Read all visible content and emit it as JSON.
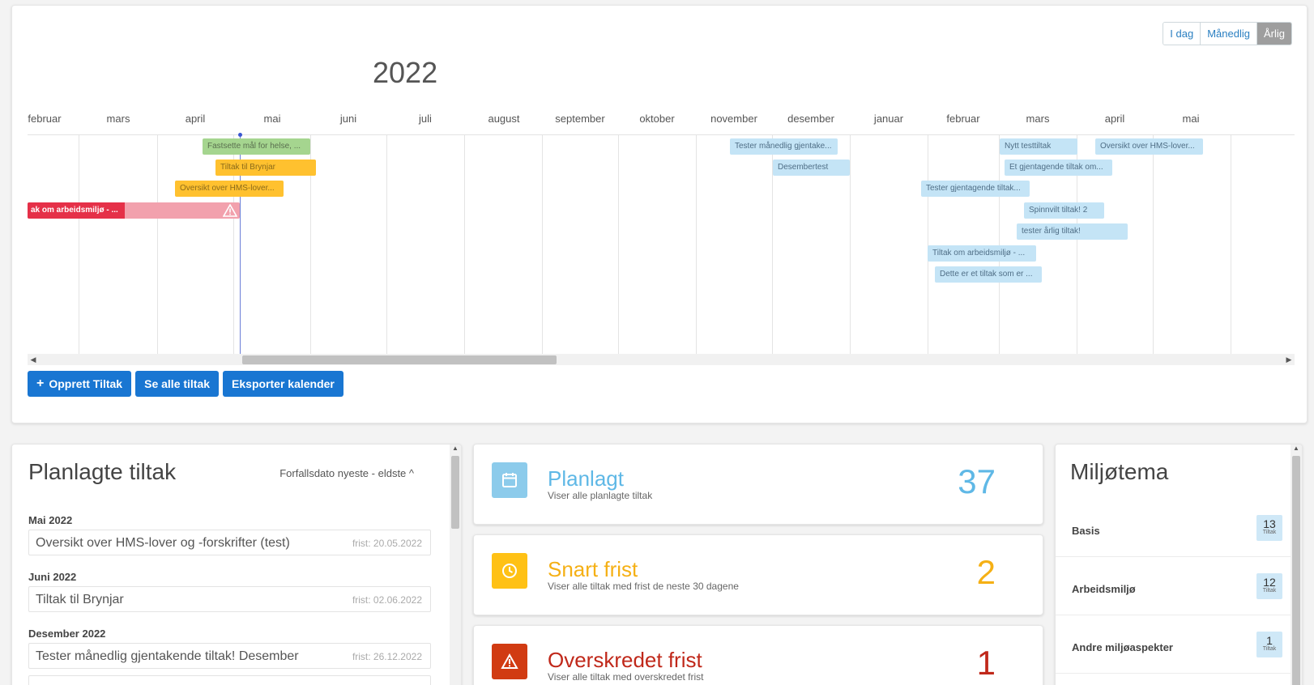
{
  "calendar": {
    "year": "2022",
    "view_buttons": [
      {
        "label": "I dag",
        "active": false
      },
      {
        "label": "Månedlig",
        "active": false
      },
      {
        "label": "Årlig",
        "active": true
      }
    ],
    "months": [
      "februar",
      "mars",
      "april",
      "mai",
      "juni",
      "juli",
      "august",
      "september",
      "oktober",
      "november",
      "desember",
      "januar",
      "februar",
      "mars",
      "april",
      "mai"
    ],
    "events": [
      {
        "label": "Fastsette mål for helse, ...",
        "color": "green"
      },
      {
        "label": "Tiltak til Brynjar",
        "color": "orange"
      },
      {
        "label": "Oversikt over HMS-lover...",
        "color": "orange"
      },
      {
        "label": "ak om arbeidsmiljø - ...",
        "color": "red"
      },
      {
        "label": "Tester månedlig gjentake...",
        "color": "blue"
      },
      {
        "label": "Desembertest",
        "color": "blue"
      },
      {
        "label": "Nytt testtiltak",
        "color": "blue"
      },
      {
        "label": "Oversikt over HMS-lover...",
        "color": "blue"
      },
      {
        "label": "Et gjentagende tiltak om...",
        "color": "blue"
      },
      {
        "label": "Tester gjentagende tiltak...",
        "color": "blue"
      },
      {
        "label": "Spinnvilt tiltak! 2",
        "color": "blue"
      },
      {
        "label": "tester årlig tiltak!",
        "color": "blue"
      },
      {
        "label": "Tiltak om arbeidsmiljø - ...",
        "color": "blue"
      },
      {
        "label": "Dette er et tiltak som er ...",
        "color": "blue"
      }
    ],
    "actions": {
      "create": "Opprett Tiltak",
      "see_all": "Se alle tiltak",
      "export": "Eksporter kalender"
    }
  },
  "planned": {
    "title": "Planlagte tiltak",
    "sort_label": "Forfallsdato nyeste - eldste ^",
    "groups": [
      {
        "label": "Mai 2022",
        "item": {
          "title": "Oversikt over HMS-lover og -forskrifter (test)",
          "due": "frist: 20.05.2022"
        }
      },
      {
        "label": "Juni 2022",
        "item": {
          "title": "Tiltak til Brynjar",
          "due": "frist: 02.06.2022"
        }
      },
      {
        "label": "Desember 2022",
        "item": {
          "title": "Tester månedlig gjentakende tiltak! Desember",
          "due": "frist: 26.12.2022"
        }
      }
    ]
  },
  "stats": [
    {
      "title": "Planlagt",
      "subtitle": "Viser alle planlagte tiltak",
      "count": "37",
      "color": "#5fb8e6",
      "icon_bg": "#8ccbeb",
      "icon": "calendar-icon"
    },
    {
      "title": "Snart frist",
      "subtitle": "Viser alle tiltak med frist de neste 30 dagene",
      "count": "2",
      "color": "#f5b015",
      "icon_bg": "#ffc115",
      "icon": "clock-icon"
    },
    {
      "title": "Overskredet frist",
      "subtitle": "Viser alle tiltak med overskredet frist",
      "count": "1",
      "color": "#c0281a",
      "icon_bg": "#d13b12",
      "icon": "warning-icon"
    }
  ],
  "environment": {
    "title": "Miljøtema",
    "items": [
      {
        "name": "Basis",
        "count": "13",
        "unit": "Tiltak"
      },
      {
        "name": "Arbeidsmiljø",
        "count": "12",
        "unit": "Tiltak"
      },
      {
        "name": "Andre miljøaspekter",
        "count": "1",
        "unit": "Tiltak"
      }
    ]
  }
}
